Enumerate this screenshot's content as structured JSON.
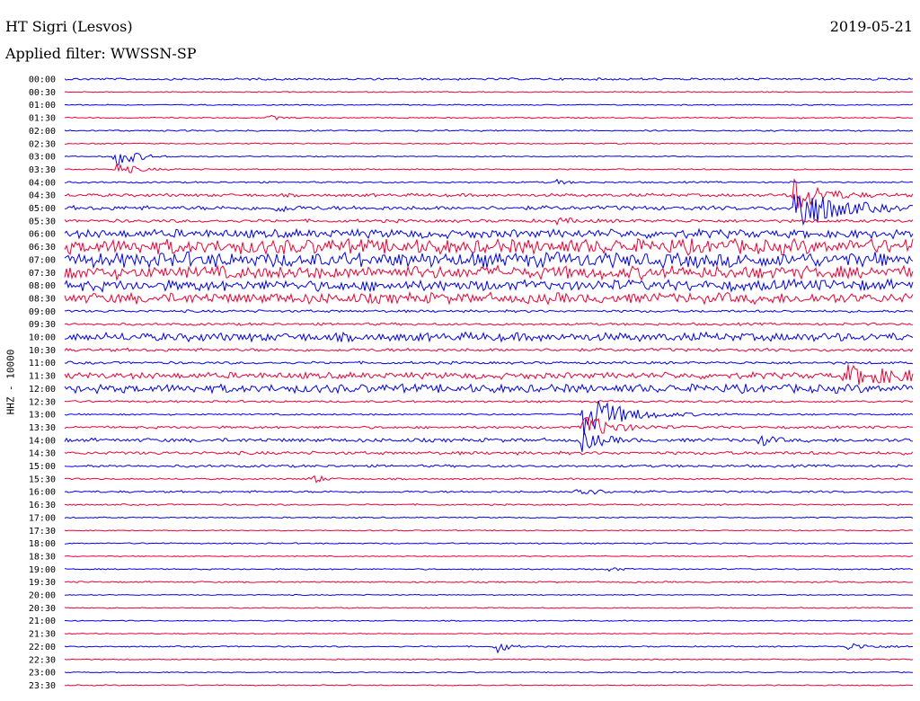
{
  "header": {
    "station": "HT Sigri (Lesvos)",
    "date": "2019-05-21",
    "filter": "Applied filter: WWSSN-SP"
  },
  "chart_data": {
    "type": "line",
    "channel_label": "HHZ - 10000",
    "colors": {
      "even": "#0000ee",
      "odd": "#ee0033"
    },
    "time_labels": [
      "00:00",
      "00:30",
      "01:00",
      "01:30",
      "02:00",
      "02:30",
      "03:00",
      "03:30",
      "04:00",
      "04:30",
      "05:00",
      "05:30",
      "06:00",
      "06:30",
      "07:00",
      "07:30",
      "08:00",
      "08:30",
      "09:00",
      "09:30",
      "10:00",
      "10:30",
      "11:00",
      "11:30",
      "12:00",
      "12:30",
      "13:00",
      "13:30",
      "14:00",
      "14:30",
      "15:00",
      "15:30",
      "16:00",
      "16:30",
      "17:00",
      "17:30",
      "18:00",
      "18:30",
      "19:00",
      "19:30",
      "20:00",
      "20:30",
      "21:00",
      "21:30",
      "22:00",
      "22:30",
      "23:00",
      "23:30"
    ],
    "trace_noise": [
      1,
      0.5,
      0.5,
      0.6,
      0.7,
      0.6,
      0.5,
      0.6,
      0.8,
      1.5,
      2,
      1.5,
      4,
      7,
      7,
      6,
      5,
      5,
      1.2,
      1.2,
      4,
      1.5,
      1.2,
      3,
      4,
      1,
      0.8,
      1.2,
      1.8,
      1.5,
      1.2,
      0.8,
      1,
      0.7,
      0.6,
      0.5,
      0.6,
      0.5,
      0.6,
      0.7,
      0.5,
      0.5,
      0.5,
      0.5,
      0.6,
      0.5,
      0.5,
      0.5
    ],
    "events": [
      {
        "trace": 3,
        "at": 0.24,
        "amp": 3,
        "width": 0.012
      },
      {
        "trace": 6,
        "at": 0.06,
        "amp": 14,
        "width": 0.02
      },
      {
        "trace": 7,
        "at": 0.06,
        "amp": 8,
        "width": 0.02
      },
      {
        "trace": 8,
        "at": 0.58,
        "amp": 3,
        "width": 0.01
      },
      {
        "trace": 10,
        "at": 0.25,
        "amp": 6,
        "width": 0.01
      },
      {
        "trace": 10,
        "at": 0.86,
        "amp": 30,
        "width": 0.04
      },
      {
        "trace": 9,
        "at": 0.86,
        "amp": 20,
        "width": 0.03
      },
      {
        "trace": 11,
        "at": 0.58,
        "amp": 3,
        "width": 0.02
      },
      {
        "trace": 23,
        "at": 0.92,
        "amp": 10,
        "width": 0.08
      },
      {
        "trace": 26,
        "at": 0.61,
        "amp": 26,
        "width": 0.04
      },
      {
        "trace": 27,
        "at": 0.61,
        "amp": 16,
        "width": 0.03
      },
      {
        "trace": 28,
        "at": 0.61,
        "amp": 12,
        "width": 0.02
      },
      {
        "trace": 28,
        "at": 0.82,
        "amp": 8,
        "width": 0.01
      },
      {
        "trace": 31,
        "at": 0.29,
        "amp": 8,
        "width": 0.01
      },
      {
        "trace": 32,
        "at": 0.6,
        "amp": 7,
        "width": 0.02
      },
      {
        "trace": 38,
        "at": 0.64,
        "amp": 4,
        "width": 0.01
      },
      {
        "trace": 44,
        "at": 0.51,
        "amp": 10,
        "width": 0.01
      },
      {
        "trace": 44,
        "at": 0.92,
        "amp": 4,
        "width": 0.03
      }
    ]
  }
}
